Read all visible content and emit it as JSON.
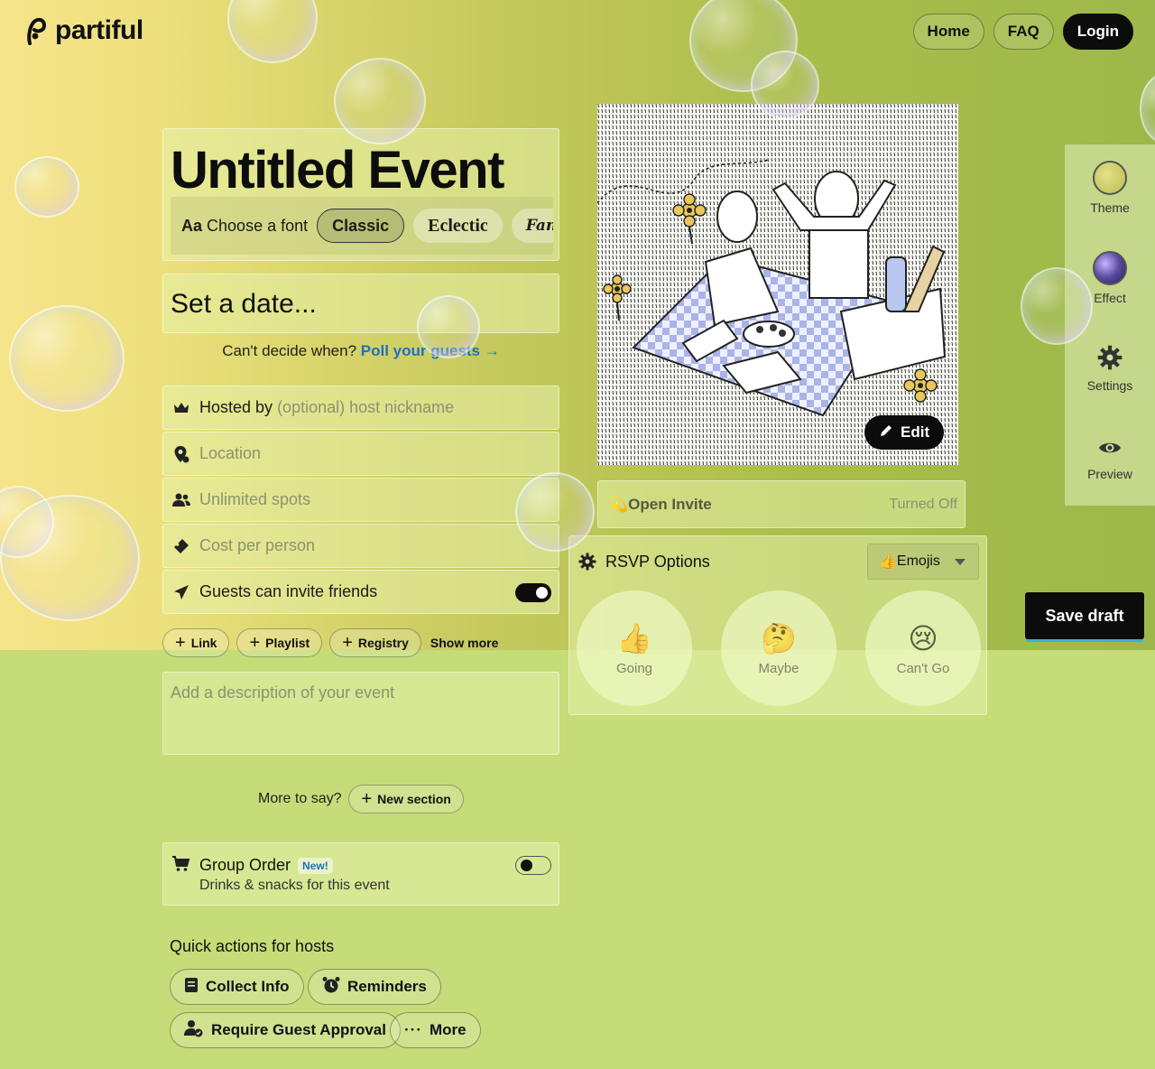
{
  "brand": {
    "name": "partiful"
  },
  "nav": {
    "home": "Home",
    "faq": "FAQ",
    "login": "Login"
  },
  "event": {
    "title": "Untitled Event",
    "font_label_prefix": "Aa",
    "font_label": "Choose a font",
    "fonts": [
      "Classic",
      "Eclectic",
      "Fan"
    ],
    "selected_font": "Classic",
    "date_placeholder": "Set a date...",
    "poll_prompt": "Can't decide when?",
    "poll_link": "Poll your guests",
    "hosted_by_label": "Hosted by",
    "hosted_by_placeholder": "(optional) host nickname",
    "location_placeholder": "Location",
    "spots_placeholder": "Unlimited spots",
    "cost_placeholder": "Cost per person",
    "guests_invite_label": "Guests can invite friends",
    "guests_invite_on": true,
    "description_placeholder": "Add a description of your event"
  },
  "addons": {
    "link": "Link",
    "playlist": "Playlist",
    "registry": "Registry",
    "show_more": "Show more"
  },
  "sections": {
    "more_to_say": "More to say?",
    "new_section": "New section"
  },
  "group_order": {
    "title": "Group Order",
    "badge": "New!",
    "subtitle": "Drinks & snacks for this event",
    "enabled": false
  },
  "quick_actions": {
    "title": "Quick actions for hosts",
    "collect_info": "Collect Info",
    "reminders": "Reminders",
    "require_approval": "Require Guest Approval",
    "more": "More"
  },
  "image": {
    "edit": "Edit"
  },
  "open_invite": {
    "icon": "💫",
    "title": "Open Invite",
    "status": "Turned Off"
  },
  "rsvp": {
    "title": "RSVP Options",
    "style": "Emojis",
    "style_icon": "👍",
    "options": [
      {
        "emoji": "👍",
        "label": "Going"
      },
      {
        "emoji": "🤔",
        "label": "Maybe"
      },
      {
        "emoji": "😢",
        "label": "Can't Go"
      }
    ]
  },
  "sidebar": {
    "theme": "Theme",
    "effect": "Effect",
    "settings": "Settings",
    "preview": "Preview"
  },
  "save_draft": "Save draft",
  "colors": {
    "accent_link": "#1f6fc5",
    "dark_button": "#0c0c0c"
  }
}
